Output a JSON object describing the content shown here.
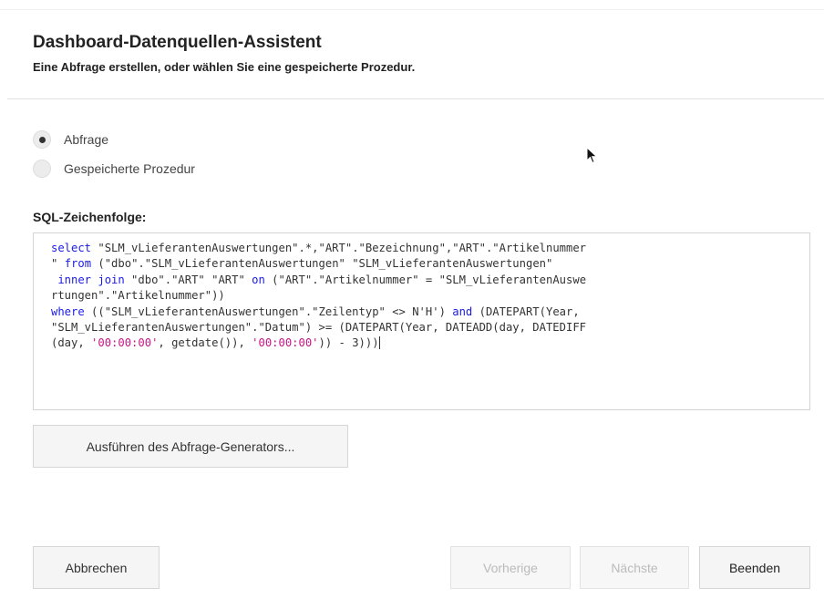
{
  "dialog": {
    "title": "Dashboard-Datenquellen-Assistent",
    "subtitle": "Eine Abfrage erstellen, oder wählen Sie eine gespeicherte Prozedur."
  },
  "options": {
    "query_label": "Abfrage",
    "stored_procedure_label": "Gespeicherte Prozedur",
    "selected": "Abfrage"
  },
  "sql": {
    "label": "SQL-Zeichenfolge:",
    "tokens": {
      "select": "select",
      "t1": " \"SLM_vLieferantenAuswertungen\".*,\"ART\".\"Bezeichnung\",\"ART\".\"Artikelnummer",
      "t2": "\" ",
      "from": "from",
      "t3": " (\"dbo\".\"SLM_vLieferantenAuswertungen\" \"SLM_vLieferantenAuswertungen\"",
      "inner_join": " inner join",
      "t4": " \"dbo\".\"ART\" \"ART\" ",
      "on": "on",
      "t5": " (\"ART\".\"Artikelnummer\" = \"SLM_vLieferantenAuswe",
      "t6": "rtungen\".\"Artikelnummer\"))",
      "where": "where",
      "t7": " ((\"SLM_vLieferantenAuswertungen\".\"Zeilentyp\" <> N'H') ",
      "and": "and",
      "t8": " (DATEPART(Year,",
      "t9": "\"SLM_vLieferantenAuswertungen\".\"Datum\") >= (DATEPART(Year, DATEADD(day, DATEDIFF",
      "t10": "(day, ",
      "s1": "'00:00:00'",
      "t11": ", getdate()), ",
      "s2": "'00:00:00'",
      "t12": ")) - 3)))"
    }
  },
  "buttons": {
    "query_builder": "Ausführen des Abfrage-Generators...",
    "cancel": "Abbrechen",
    "previous": "Vorherige",
    "next": "Nächste",
    "finish": "Beenden"
  }
}
